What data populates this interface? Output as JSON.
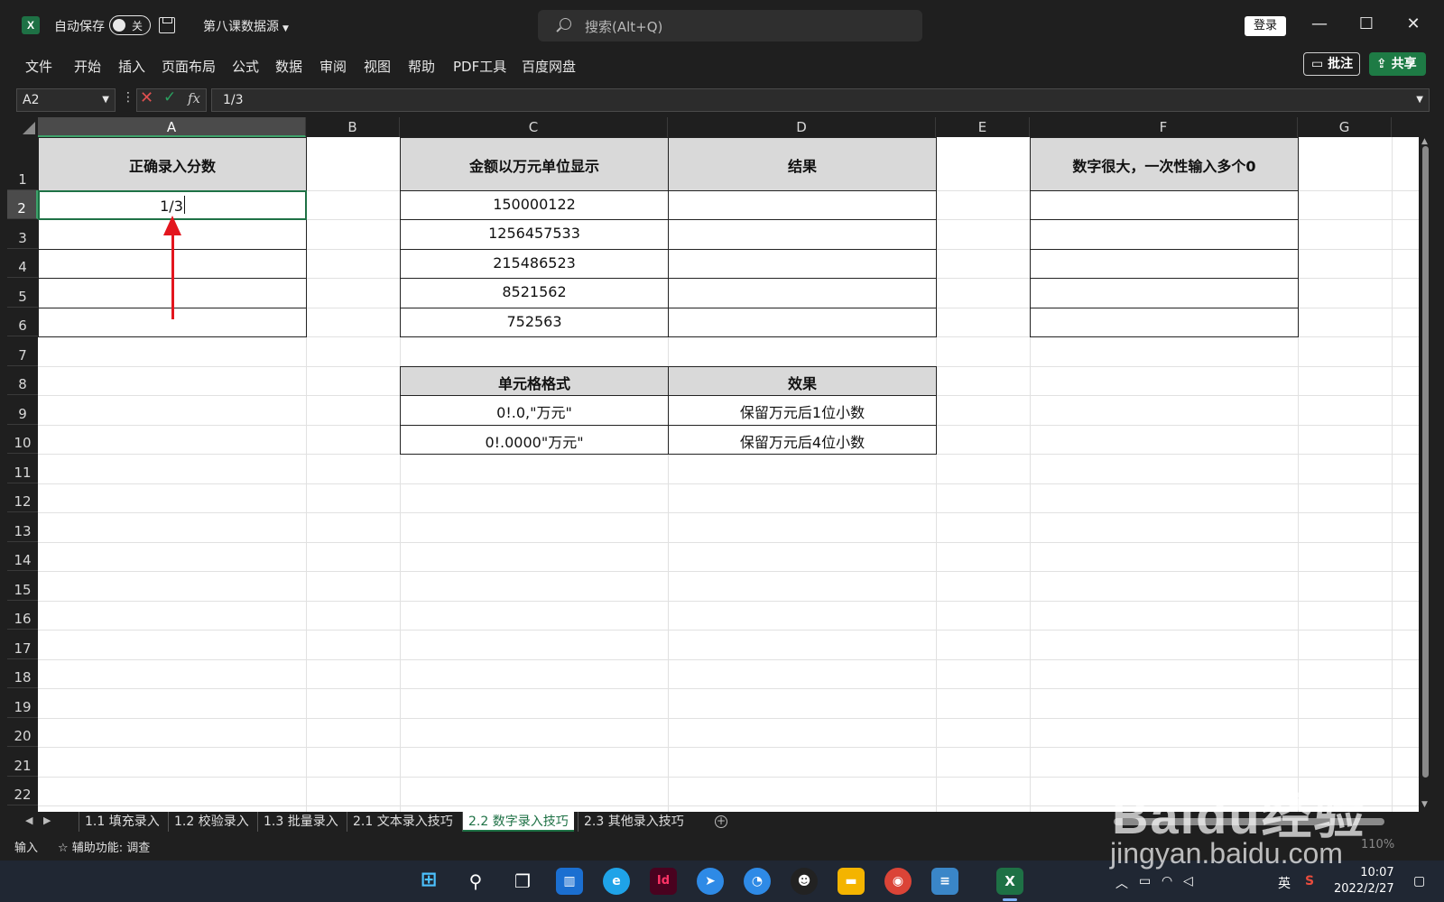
{
  "titlebar": {
    "app_logo": "X",
    "autosave_label": "自动保存",
    "autosave_state": "关",
    "filename": "第八课数据源",
    "search_placeholder": "搜索(Alt+Q)",
    "login_label": "登录",
    "controls": {
      "minimize": "—",
      "maximize": "☐",
      "close": "✕"
    }
  },
  "menu": {
    "items": [
      "文件",
      "开始",
      "插入",
      "页面布局",
      "公式",
      "数据",
      "审阅",
      "视图",
      "帮助",
      "PDF工具",
      "百度网盘"
    ],
    "comment_label": "批注",
    "share_label": "共享"
  },
  "formula_bar": {
    "name_box": "A2",
    "fx_label": "fx",
    "content": "1/3"
  },
  "columns": [
    "A",
    "B",
    "C",
    "D",
    "E",
    "F",
    "G"
  ],
  "rows": [
    "1",
    "2",
    "3",
    "4",
    "5",
    "6",
    "7",
    "8",
    "9",
    "10",
    "11",
    "12",
    "13",
    "14",
    "15",
    "16",
    "17",
    "18",
    "19",
    "20",
    "21",
    "22"
  ],
  "cells": {
    "a1": "正确录入分数",
    "a2": "1/3",
    "c1": "金额以万元单位显示",
    "d1": "结果",
    "f1": "数字很大，一次性输入多个0",
    "c_values": [
      "150000122",
      "1256457533",
      "215486523",
      "8521562",
      "752563"
    ],
    "c8": "单元格格式",
    "d8": "效果",
    "format_rows": [
      {
        "format": "0!.0,\"万元\"",
        "effect": "保留万元后1位小数"
      },
      {
        "format": "0!.0000\"万元\"",
        "effect": "保留万元后4位小数"
      }
    ]
  },
  "sheet_tabs": [
    "1.1 填充录入",
    "1.2 校验录入",
    "1.3 批量录入",
    "2.1 文本录入技巧",
    "2.2 数字录入技巧",
    "2.3 其他录入技巧"
  ],
  "active_tab": "2.2 数字录入技巧",
  "status": {
    "mode": "输入",
    "accessibility": "辅助功能: 调查",
    "zoom": "110%"
  },
  "taskbar": {
    "clock_time": "10:07",
    "clock_date": "2022/2/27",
    "ime": "英"
  },
  "watermark": {
    "brand": "Baidu经验",
    "url": "jingyan.baidu.com"
  },
  "colors": {
    "excel_green": "#1e7145",
    "header_fill": "#d9d9d9",
    "annotation_arrow": "#e3161e"
  }
}
